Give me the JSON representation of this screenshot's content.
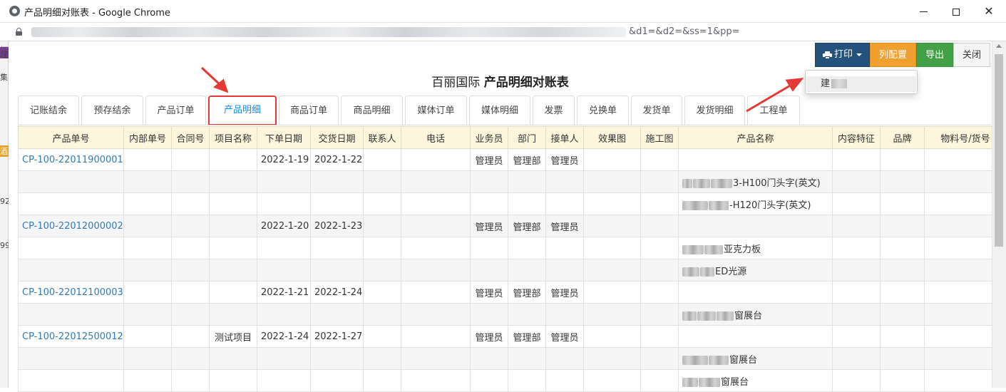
{
  "window": {
    "title": "产品明细对账表 - Google Chrome"
  },
  "address": {
    "url_visible": "&d1=&d2=&ss=1&pp="
  },
  "background_window": {
    "fragments": [
      "杯",
      "理",
      "集",
      "酒",
      "92",
      "99"
    ]
  },
  "toolbar": {
    "print_label": "打印",
    "columns_label": "列配置",
    "export_label": "导出",
    "close_label": "关闭"
  },
  "print_menu": {
    "item_label": "建"
  },
  "page": {
    "company": "百丽国际",
    "report_title": "产品明细对账表"
  },
  "tabs": [
    {
      "label": "记账结余"
    },
    {
      "label": "预存结余"
    },
    {
      "label": "产品订单"
    },
    {
      "label": "产品明细",
      "active": true
    },
    {
      "label": "商品订单"
    },
    {
      "label": "商品明细"
    },
    {
      "label": "媒体订单"
    },
    {
      "label": "媒体明细"
    },
    {
      "label": "发票"
    },
    {
      "label": "兑换单"
    },
    {
      "label": "发货单"
    },
    {
      "label": "发货明细"
    },
    {
      "label": "工程单"
    }
  ],
  "table": {
    "columns": [
      "产品单号",
      "内部单号",
      "合同号",
      "项目名称",
      "下单日期",
      "交货日期",
      "联系人",
      "电话",
      "业务员",
      "部门",
      "接单人",
      "效果图",
      "施工图",
      "产品名称",
      "内容特征",
      "品牌",
      "物料号/货号"
    ],
    "rows": [
      {
        "order_no": "CP-100-22011900001",
        "project": "",
        "order_date": "2022-1-19",
        "delivery_date": "2022-1-22",
        "salesman": "管理员",
        "dept": "管理部",
        "receiver": "管理员",
        "product": ""
      },
      {
        "order_no": "",
        "project": "",
        "order_date": "",
        "delivery_date": "",
        "salesman": "",
        "dept": "",
        "receiver": "",
        "product": "3-H100门头字(英文)"
      },
      {
        "order_no": "",
        "project": "",
        "order_date": "",
        "delivery_date": "",
        "salesman": "",
        "dept": "",
        "receiver": "",
        "product": "-H120门头字(英文)"
      },
      {
        "order_no": "CP-100-22012000002",
        "project": "",
        "order_date": "2022-1-20",
        "delivery_date": "2022-1-23",
        "salesman": "管理员",
        "dept": "管理部",
        "receiver": "管理员",
        "product": ""
      },
      {
        "order_no": "",
        "project": "",
        "order_date": "",
        "delivery_date": "",
        "salesman": "",
        "dept": "",
        "receiver": "",
        "product": "亚克力板"
      },
      {
        "order_no": "",
        "project": "",
        "order_date": "",
        "delivery_date": "",
        "salesman": "",
        "dept": "",
        "receiver": "",
        "product": "ED光源"
      },
      {
        "order_no": "CP-100-22012100003",
        "project": "",
        "order_date": "2022-1-21",
        "delivery_date": "2022-1-24",
        "salesman": "管理员",
        "dept": "管理部",
        "receiver": "管理员",
        "product": ""
      },
      {
        "order_no": "",
        "project": "",
        "order_date": "",
        "delivery_date": "",
        "salesman": "",
        "dept": "",
        "receiver": "",
        "product": "窗展台"
      },
      {
        "order_no": "CP-100-22012500012",
        "project": "测试项目",
        "order_date": "2022-1-24",
        "delivery_date": "2022-1-27",
        "salesman": "管理员",
        "dept": "管理部",
        "receiver": "管理员",
        "product": ""
      },
      {
        "order_no": "",
        "project": "",
        "order_date": "",
        "delivery_date": "",
        "salesman": "",
        "dept": "",
        "receiver": "",
        "product": "窗展台"
      },
      {
        "order_no": "",
        "project": "",
        "order_date": "",
        "delivery_date": "",
        "salesman": "",
        "dept": "",
        "receiver": "",
        "product": "窗展台"
      }
    ]
  },
  "colors": {
    "header_bg": "#fdf6dd",
    "link": "#337ab7",
    "print_btn": "#23527c",
    "columns_btn": "#f0a030",
    "export_btn": "#44a047",
    "annotation": "#e53935"
  }
}
